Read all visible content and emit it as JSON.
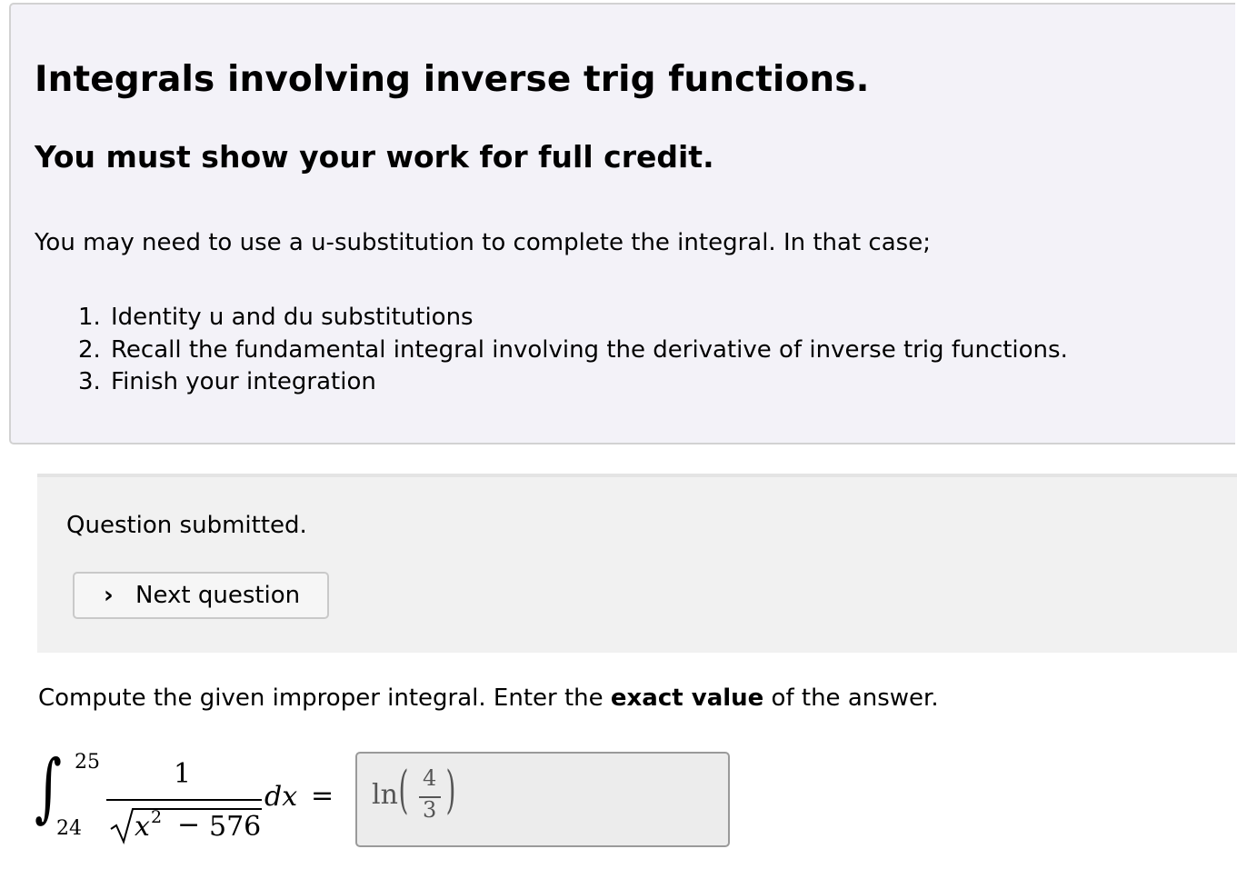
{
  "intro": {
    "title": "Integrals involving inverse trig functions.",
    "subtitle": "You must show your work for full credit.",
    "paragraph": "You may need to use a u-substitution to complete the integral.  In that case;",
    "steps": [
      {
        "num": "1.",
        "text": "Identity u and du substitutions"
      },
      {
        "num": "2.",
        "text": "Recall the fundamental integral involving the derivative of inverse trig functions."
      },
      {
        "num": "3.",
        "text": "Finish your integration"
      }
    ]
  },
  "status": {
    "message": "Question submitted.",
    "next_icon": "›",
    "next_label": "Next question"
  },
  "question": {
    "prompt_before": "Compute the given improper integral. Enter the ",
    "prompt_bold": "exact value",
    "prompt_after": " of the answer."
  },
  "integral": {
    "sign": "∫",
    "upper_limit": "25",
    "lower_limit": "24",
    "numerator": "1",
    "variable": "x",
    "exponent": "2",
    "minus": "−",
    "constant": "576",
    "differential": "dx",
    "equals": "="
  },
  "answer": {
    "function": "ln",
    "left_paren": "(",
    "numerator": "4",
    "denominator": "3",
    "right_paren": ")"
  }
}
